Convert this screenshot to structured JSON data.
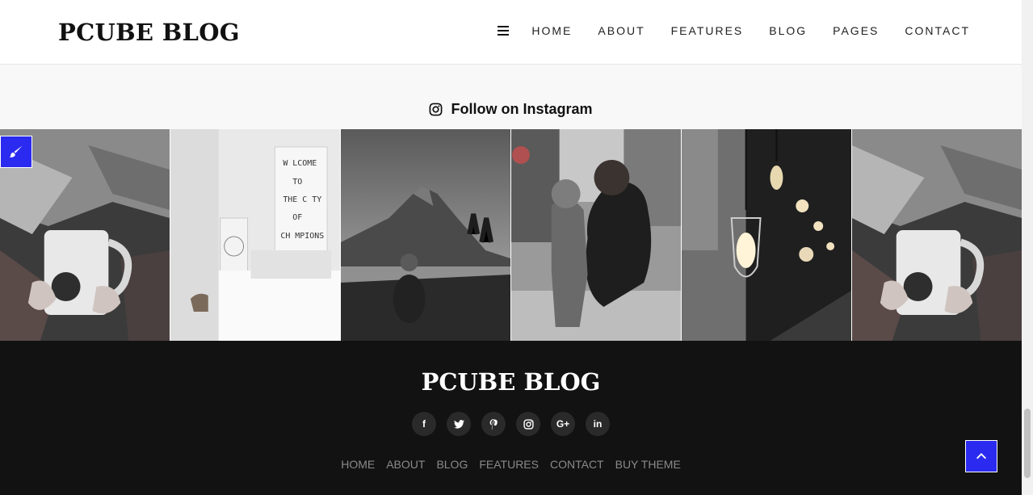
{
  "header": {
    "logo": "PCUBE BLOG",
    "menu_icon": "hamburger-icon",
    "nav": [
      "HOME",
      "ABOUT",
      "FEATURES",
      "BLOG",
      "PAGES",
      "CONTACT"
    ]
  },
  "instagram": {
    "icon": "instagram-icon",
    "title": "Follow on Instagram"
  },
  "footer": {
    "logo": "PCUBE BLOG",
    "socials": [
      {
        "icon": "facebook-icon",
        "glyph": "f"
      },
      {
        "icon": "twitter-icon",
        "glyph": "t"
      },
      {
        "icon": "pinterest-icon",
        "glyph": "p"
      },
      {
        "icon": "instagram-icon",
        "glyph": "◎"
      },
      {
        "icon": "google-plus-icon",
        "glyph": "G+"
      },
      {
        "icon": "linkedin-icon",
        "glyph": "in"
      }
    ],
    "links": [
      "HOME",
      "ABOUT",
      "BLOG",
      "FEATURES",
      "CONTACT",
      "BUY THEME"
    ]
  },
  "widgets": {
    "customizer_icon": "paint-brush-icon",
    "back_to_top_icon": "chevron-up-icon"
  },
  "colors": {
    "accent": "#2a2af0",
    "footer_bg": "#121212",
    "page_bg": "#f8f8f8"
  }
}
